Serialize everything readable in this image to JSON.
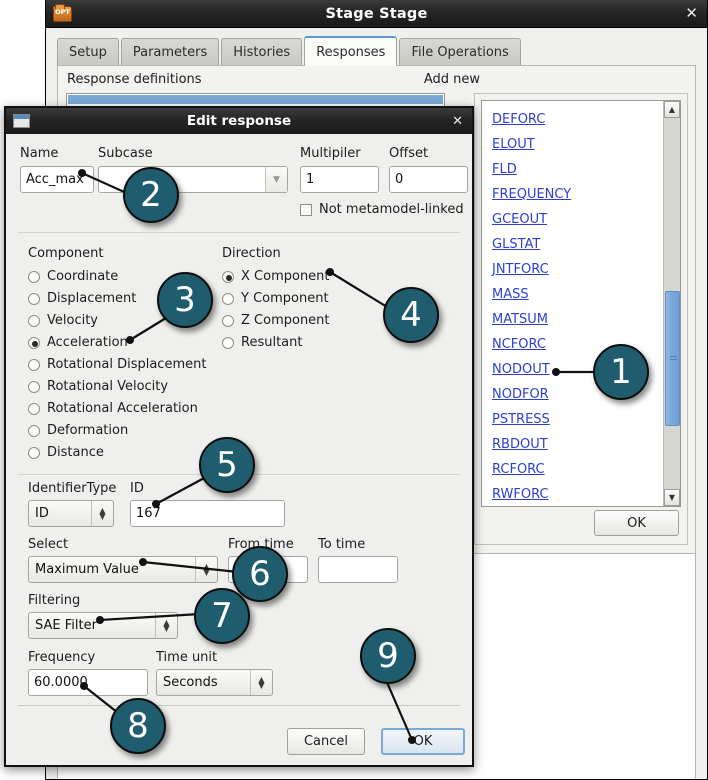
{
  "main_window": {
    "title": "Stage Stage",
    "icon": "opt-folder-icon",
    "icon_label": "OPT",
    "close_label": "✕",
    "tabs": [
      {
        "label": "Setup",
        "active": false
      },
      {
        "label": "Parameters",
        "active": false
      },
      {
        "label": "Histories",
        "active": false
      },
      {
        "label": "Responses",
        "active": true
      },
      {
        "label": "File Operations",
        "active": false
      }
    ],
    "response_definitions_label": "Response definitions",
    "add_new_label": "Add new",
    "add_new_items": [
      "DEFORC",
      "ELOUT",
      "FLD",
      "FREQUENCY",
      "GCEOUT",
      "GLSTAT",
      "JNTFORC",
      "MASS",
      "MATSUM",
      "NCFORC",
      "NODOUT",
      "NODFOR",
      "PSTRESS",
      "RBDOUT",
      "RCFORC",
      "RWFORC"
    ],
    "scroll_up_glyph": "▲",
    "scroll_down_glyph": "▼",
    "ok_label": "OK"
  },
  "dialog": {
    "title": "Edit response",
    "icon": "window-icon",
    "close_label": "✕",
    "name_label": "Name",
    "name_value": "Acc_max",
    "subcase_label": "Subcase",
    "subcase_value": "",
    "multiplier_label": "Multipiler",
    "multiplier_value": "1",
    "offset_label": "Offset",
    "offset_value": "0",
    "not_metamodel_label": "Not metamodel-linked",
    "not_metamodel_checked": false,
    "component_label": "Component",
    "component_options": [
      {
        "label": "Coordinate",
        "selected": false
      },
      {
        "label": "Displacement",
        "selected": false
      },
      {
        "label": "Velocity",
        "selected": false
      },
      {
        "label": "Acceleration",
        "selected": true
      },
      {
        "label": "Rotational Displacement",
        "selected": false
      },
      {
        "label": "Rotational Velocity",
        "selected": false
      },
      {
        "label": "Rotational Acceleration",
        "selected": false
      },
      {
        "label": "Deformation",
        "selected": false
      },
      {
        "label": "Distance",
        "selected": false
      }
    ],
    "direction_label": "Direction",
    "direction_options": [
      {
        "label": "X Component",
        "selected": true
      },
      {
        "label": "Y Component",
        "selected": false
      },
      {
        "label": "Z Component",
        "selected": false
      },
      {
        "label": "Resultant",
        "selected": false
      }
    ],
    "identifier_type_label": "IdentifierType",
    "identifier_type_value": "ID",
    "id_label": "ID",
    "id_value": "167",
    "select_label": "Select",
    "select_value": "Maximum Value",
    "from_time_label": "From time",
    "from_time_value": "",
    "to_time_label": "To time",
    "to_time_value": "",
    "filtering_label": "Filtering",
    "filtering_value": "SAE Filter",
    "frequency_label": "Frequency",
    "frequency_value": "60.0000",
    "time_unit_label": "Time unit",
    "time_unit_value": "Seconds",
    "cancel_label": "Cancel",
    "ok_label": "OK"
  },
  "callouts": [
    {
      "n": "1"
    },
    {
      "n": "2"
    },
    {
      "n": "3"
    },
    {
      "n": "4"
    },
    {
      "n": "5"
    },
    {
      "n": "6"
    },
    {
      "n": "7"
    },
    {
      "n": "8"
    },
    {
      "n": "9"
    }
  ],
  "colors": {
    "callout_fill": "#1e5c6e",
    "link": "#2b3fd4",
    "active_tab_border": "#5b9bd5",
    "selection": "#7aa9d8"
  }
}
